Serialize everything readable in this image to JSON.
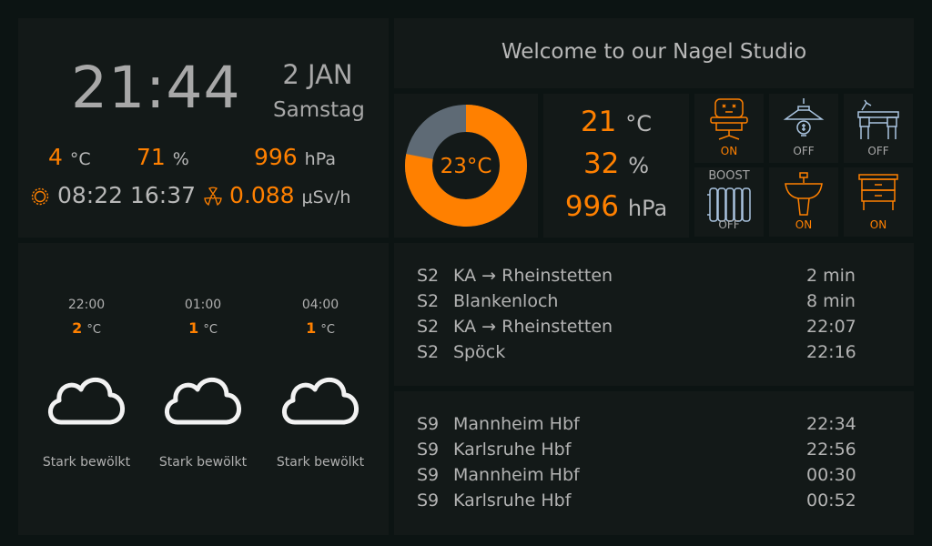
{
  "clock": {
    "time": "21:44",
    "date": "2 JAN",
    "weekday": "Samstag",
    "outdoor_temp": "4",
    "outdoor_temp_unit": "°C",
    "outdoor_humidity": "71",
    "outdoor_humidity_unit": "%",
    "pressure": "996",
    "pressure_unit": "hPa",
    "sunrise": "08:22",
    "sunset": "16:37",
    "radiation": "0.088",
    "radiation_unit": "μSv/h",
    "icons": {
      "sun": "sun-icon",
      "radiation": "radiation-icon"
    }
  },
  "welcome": {
    "title": "Welcome to our Nagel Studio"
  },
  "gauge": {
    "label": "23°C",
    "fraction": 0.78,
    "fill_color": "#ff8000",
    "track_color": "#5e6a75"
  },
  "climate": {
    "temp": "21",
    "temp_unit": "°C",
    "humidity": "32",
    "humidity_unit": "%",
    "pressure": "996",
    "pressure_unit": "hPa"
  },
  "devices": [
    {
      "icon": "massage-chair-icon",
      "state": "ON",
      "on": true
    },
    {
      "icon": "ceiling-lamp-icon",
      "state": "OFF",
      "on": false
    },
    {
      "icon": "desk-icon",
      "state": "OFF",
      "on": false
    },
    {
      "icon": "radiator-icon",
      "state": "OFF",
      "on": false,
      "top_label": "BOOST"
    },
    {
      "icon": "sink-icon",
      "state": "ON",
      "on": true
    },
    {
      "icon": "nightstand-icon",
      "state": "ON",
      "on": true
    }
  ],
  "forecast": [
    {
      "hour": "22:00",
      "temp": "2",
      "unit": "°C",
      "icon": "cloud-icon",
      "desc": "Stark bewölkt"
    },
    {
      "hour": "01:00",
      "temp": "1",
      "unit": "°C",
      "icon": "cloud-icon",
      "desc": "Stark bewölkt"
    },
    {
      "hour": "04:00",
      "temp": "1",
      "unit": "°C",
      "icon": "cloud-icon",
      "desc": "Stark bewölkt"
    }
  ],
  "transit_1": [
    {
      "line": "S2",
      "dest": "KA → Rheinstetten",
      "when": "2 min"
    },
    {
      "line": "S2",
      "dest": "Blankenloch",
      "when": "8 min"
    },
    {
      "line": "S2",
      "dest": "KA → Rheinstetten",
      "when": "22:07"
    },
    {
      "line": "S2",
      "dest": "Spöck",
      "when": "22:16"
    }
  ],
  "transit_2": [
    {
      "line": "S9",
      "dest": "Mannheim Hbf",
      "when": "22:34"
    },
    {
      "line": "S9",
      "dest": "Karlsruhe Hbf",
      "when": "22:56"
    },
    {
      "line": "S9",
      "dest": "Mannheim Hbf",
      "when": "00:30"
    },
    {
      "line": "S9",
      "dest": "Karlsruhe Hbf",
      "when": "00:52"
    }
  ]
}
